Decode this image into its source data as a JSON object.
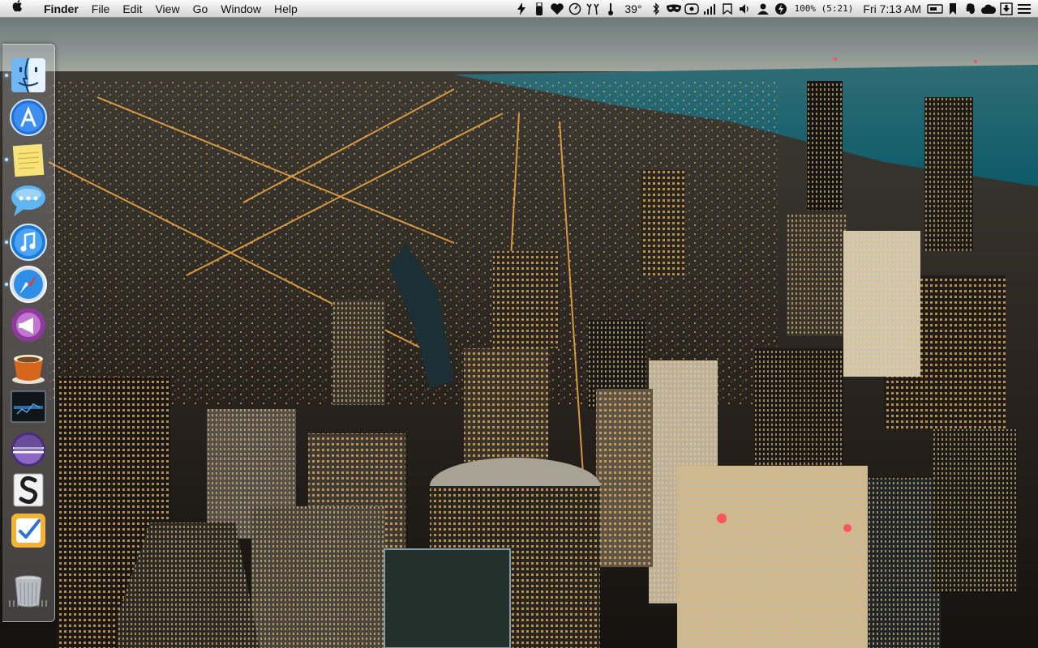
{
  "menubar": {
    "apple_icon": "apple-icon",
    "app_name": "Finder",
    "menus": [
      "File",
      "Edit",
      "View",
      "Go",
      "Window",
      "Help"
    ],
    "weather_temp": "39°",
    "battery_text": "100% (5:21)",
    "clock": "Fri 7:13 AM"
  },
  "dock": {
    "items": [
      {
        "name": "Finder",
        "icon": "finder-icon",
        "running": true
      },
      {
        "name": "App Store",
        "icon": "app-store-icon",
        "running": false
      },
      {
        "name": "Stickies",
        "icon": "stickies-icon",
        "running": true
      },
      {
        "name": "Messages",
        "icon": "messages-icon",
        "running": false
      },
      {
        "name": "iTunes",
        "icon": "itunes-icon",
        "running": true
      },
      {
        "name": "Safari",
        "icon": "safari-icon",
        "running": true
      },
      {
        "name": "Growl",
        "icon": "growl-icon",
        "running": false
      },
      {
        "name": "Caffeine",
        "icon": "caffeine-icon",
        "running": false
      },
      {
        "name": "Monitor",
        "icon": "monitor-icon",
        "running": false
      },
      {
        "name": "Eclipse",
        "icon": "eclipse-icon",
        "running": false
      },
      {
        "name": "Scrivener",
        "icon": "scrivener-icon",
        "running": false
      },
      {
        "name": "Things",
        "icon": "things-icon",
        "running": false
      }
    ],
    "trash": {
      "name": "Trash",
      "icon": "trash-icon"
    }
  },
  "wallpaper": {
    "subject": "city-skyline"
  },
  "colors": {
    "menubar": "#e6e6e6",
    "accent": "#2a7fe0"
  }
}
